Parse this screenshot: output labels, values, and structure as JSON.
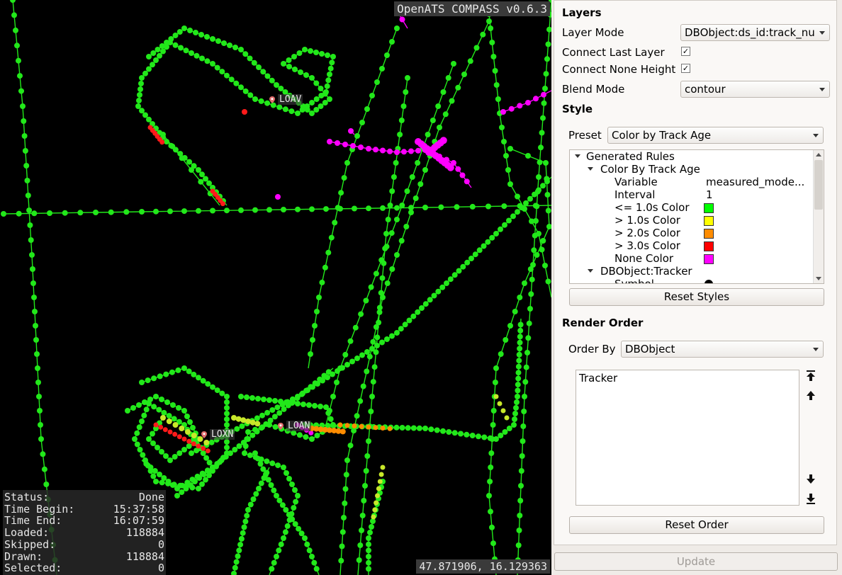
{
  "map": {
    "version": "OpenATS COMPASS v0.6.3",
    "coordinates": "47.871906, 16.129363",
    "airports": [
      "LOAV",
      "LOXN",
      "LOAN"
    ],
    "status": [
      {
        "label": "Status:",
        "value": "Done"
      },
      {
        "label": "Time Begin:",
        "value": "15:37:58"
      },
      {
        "label": "Time End:",
        "value": "16:07:59"
      },
      {
        "label": "Loaded:",
        "value": "118884"
      },
      {
        "label": "Skipped:",
        "value": "0"
      },
      {
        "label": "Drawn:",
        "value": "118884"
      },
      {
        "label": "Selected:",
        "value": "0"
      }
    ],
    "colors": {
      "track": "#22e81a",
      "age1": "#c8e82a",
      "age2": "#ff8c00",
      "age3": "#ff1a1a",
      "none": "#ff00ff"
    }
  },
  "panel": {
    "layers_title": "Layers",
    "layer_mode_label": "Layer Mode",
    "layer_mode_value": "DBObject:ds_id:track_nu",
    "connect_last_label": "Connect Last Layer",
    "connect_last_checked": true,
    "connect_none_label": "Connect None Height",
    "connect_none_checked": true,
    "blend_label": "Blend Mode",
    "blend_value": "contour",
    "style_title": "Style",
    "preset_label": "Preset",
    "preset_value": "Color by Track Age",
    "tree": {
      "root": "Generated Rules",
      "group": "Color By Track Age",
      "variable_label": "Variable",
      "variable_value": "measured_mode...",
      "interval_label": "Interval",
      "interval_value": "1",
      "rules": [
        {
          "label": "<= 1.0s Color",
          "color": "#00ff00"
        },
        {
          "label": "> 1.0s Color",
          "color": "#ffff00"
        },
        {
          "label": "> 2.0s Color",
          "color": "#ff8c00"
        },
        {
          "label": "> 3.0s Color",
          "color": "#ff0000"
        },
        {
          "label": "None Color",
          "color": "#ff00ff"
        }
      ],
      "group2": "DBObject:Tracker",
      "symbol_label": "Symbol"
    },
    "reset_styles": "Reset Styles",
    "render_title": "Render Order",
    "order_by_label": "Order By",
    "order_by_value": "DBObject",
    "order_items": [
      "Tracker"
    ],
    "reset_order": "Reset Order",
    "update": "Update"
  }
}
